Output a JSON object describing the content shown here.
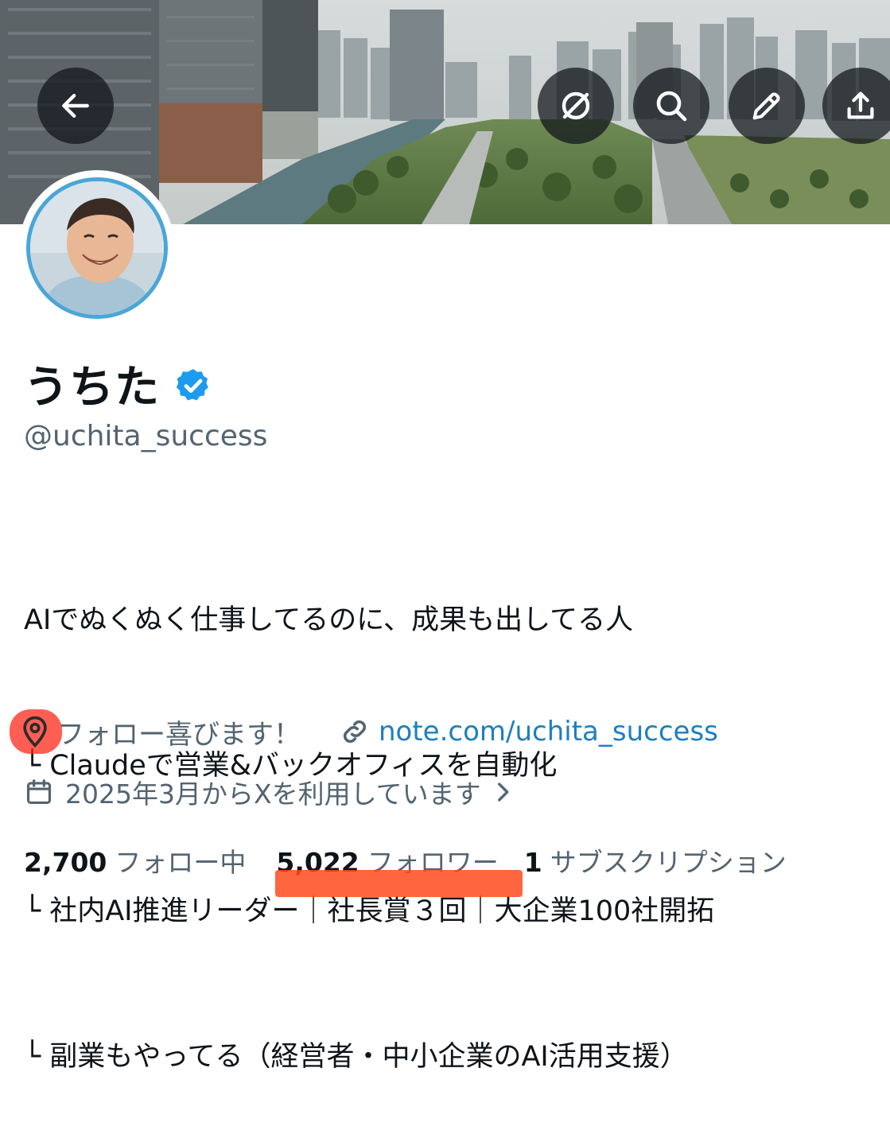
{
  "header": {
    "back_icon": "arrow-left-icon",
    "actions": [
      "grok-icon",
      "search-icon",
      "edit-icon",
      "share-icon"
    ]
  },
  "profile": {
    "name": "うちた",
    "verified": true,
    "handle": "@uchita_success",
    "bio": [
      "AIでぬくぬく仕事してるのに、成果も出してる人",
      "└ Claudeで営業&バックオフィスを自動化",
      "└ 社内AI推進リーダー｜社長賞３回｜大企業100社開拓",
      "└ 副業もやってる（経営者・中小企業のAI活用支援）"
    ],
    "location": "フォロー喜びます！",
    "link": "note.com/uchita_success",
    "joined": "2025年3月からXを利用しています"
  },
  "stats": {
    "following_count": "2,700",
    "following_label": "フォロー中",
    "followers_count": "5,022",
    "followers_label": "フォロワー",
    "subscriptions_count": "1",
    "subscriptions_label": "サブスクリプション"
  },
  "colors": {
    "accent": "#1d9bf0",
    "link": "#1d7fc0",
    "secondary_text": "#536471",
    "highlight_marker": "#ff4b1f"
  }
}
